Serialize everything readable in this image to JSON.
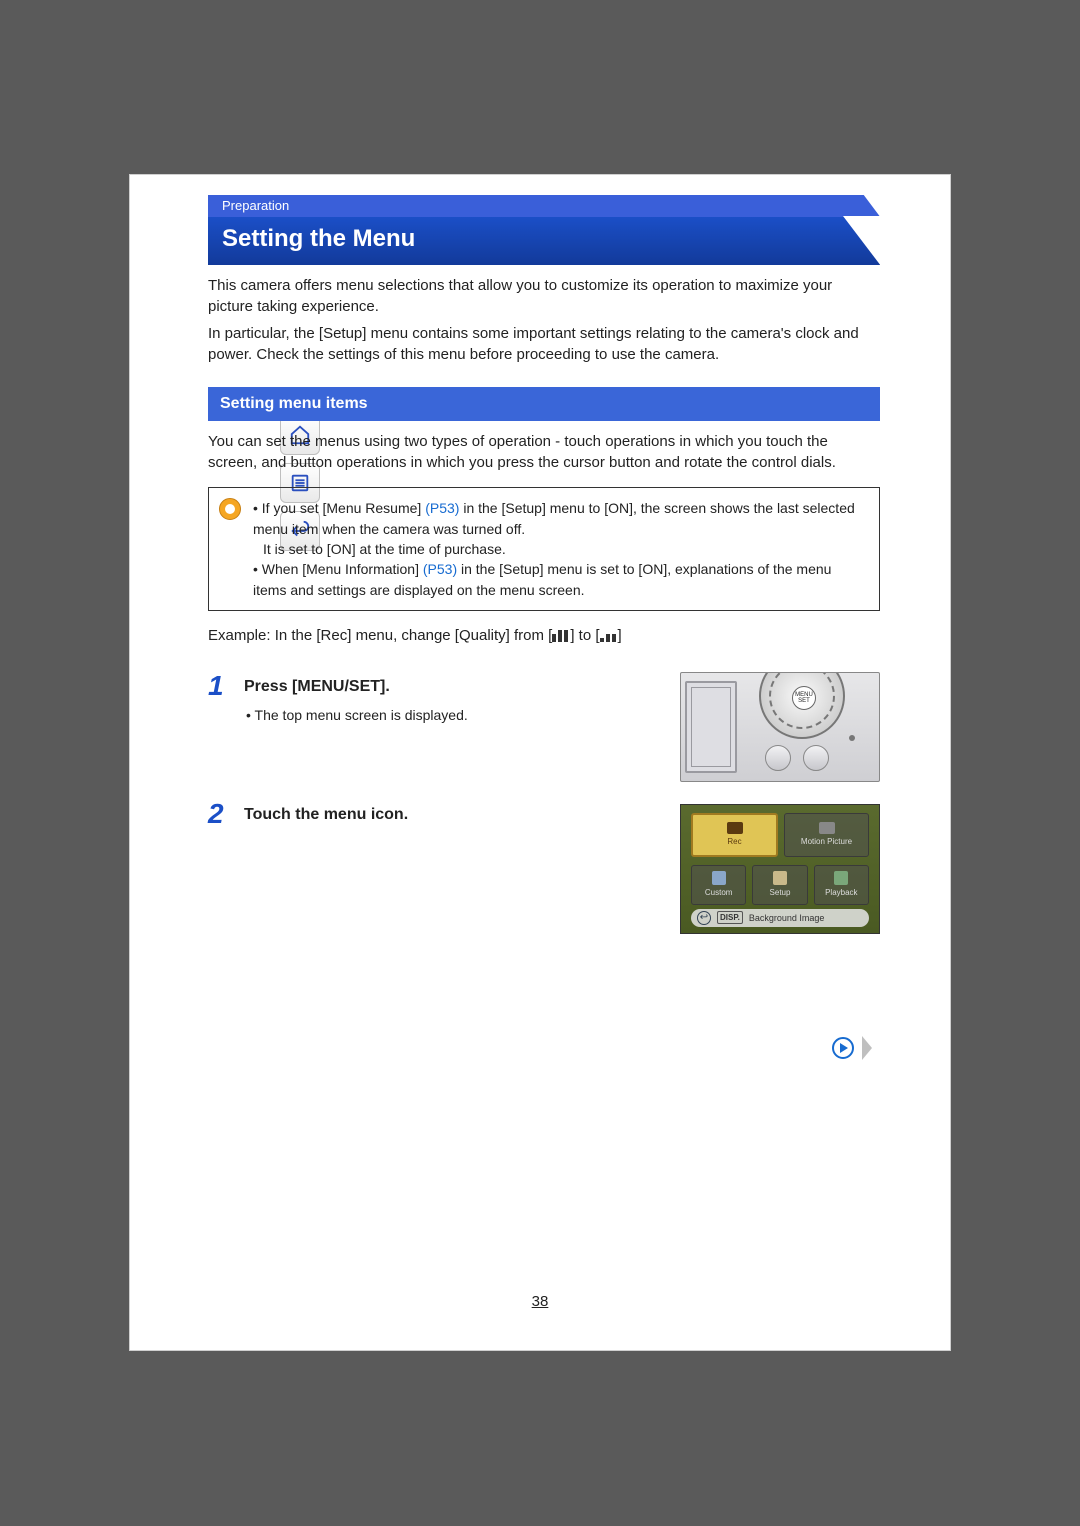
{
  "breadcrumb": "Preparation",
  "title": "Setting the Menu",
  "intro": {
    "p1": "This camera offers menu selections that allow you to customize its operation to maximize your picture taking experience.",
    "p2": "In particular, the [Setup] menu contains some important settings relating to the camera's clock and power. Check the settings of this menu before proceeding to use the camera."
  },
  "section_sub": "Setting menu items",
  "section_desc": "You can set the menus using two types of operation - touch operations in which you touch the screen, and button operations in which you press the cursor button and rotate the control dials.",
  "note": {
    "b1a": "• If you set [Menu Resume] ",
    "b1link": "(P53)",
    "b1b": " in the [Setup] menu to [ON], the screen shows the last selected menu item when the camera was turned off.",
    "b1c": "It is set to [ON] at the time of purchase.",
    "b2a": "• When [Menu Information] ",
    "b2link": "(P53)",
    "b2b": " in the [Setup] menu is set to [ON], explanations of the menu items and settings are displayed on the menu screen."
  },
  "example_a": "Example: In the [Rec] menu, change [Quality] from [",
  "example_b": "] to [",
  "example_c": "]",
  "steps": [
    {
      "no": "1",
      "title": "Press [MENU/SET].",
      "sub": "• The top menu screen is displayed."
    },
    {
      "no": "2",
      "title": "Touch the menu icon.",
      "sub": ""
    }
  ],
  "dial_label": "MENU SET",
  "touchscreen": {
    "tiles_top": [
      "Rec",
      "Motion Picture"
    ],
    "tiles_bottom": [
      "Custom",
      "Setup",
      "Playback"
    ],
    "footer_back": "↩",
    "footer_disp": "DISP.",
    "footer_text": "Background Image"
  },
  "page_number": "38"
}
